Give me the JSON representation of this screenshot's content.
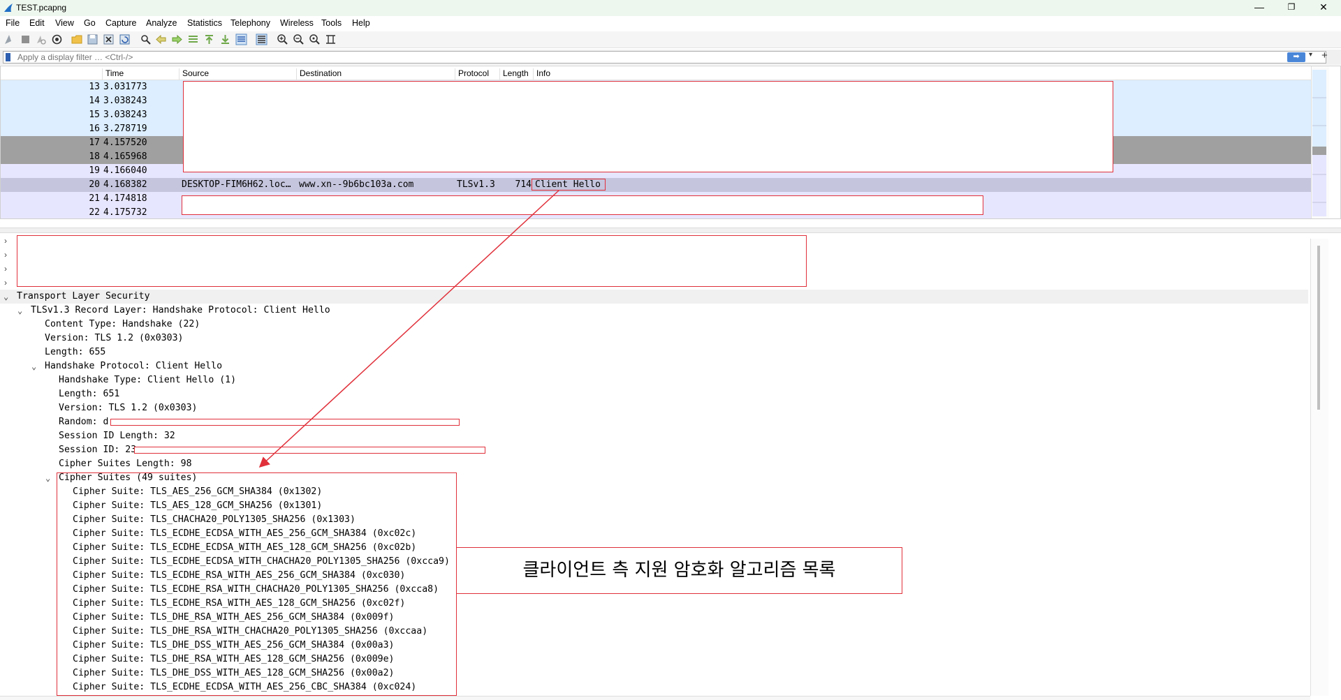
{
  "window": {
    "title": "TEST.pcapng",
    "minimize": "—",
    "restore": "❐",
    "close": "✕"
  },
  "menu": [
    "File",
    "Edit",
    "View",
    "Go",
    "Capture",
    "Analyze",
    "Statistics",
    "Telephony",
    "Wireless",
    "Tools",
    "Help"
  ],
  "filter": {
    "placeholder": "Apply a display filter … <Ctrl-/>",
    "apply_glyph": "➡"
  },
  "packet_list": {
    "columns": [
      "Time",
      "Source",
      "Destination",
      "Protocol",
      "Length",
      "Info"
    ],
    "rows": [
      {
        "no": "13",
        "time": "3.031773",
        "bg": "#dceeff"
      },
      {
        "no": "14",
        "time": "3.038243",
        "bg": "#dceeff"
      },
      {
        "no": "15",
        "time": "3.038243",
        "bg": "#dceeff"
      },
      {
        "no": "16",
        "time": "3.278719",
        "bg": "#dceeff"
      },
      {
        "no": "17",
        "time": "4.157520",
        "bg": "#a0a0a0"
      },
      {
        "no": "18",
        "time": "4.165968",
        "bg": "#a0a0a0"
      },
      {
        "no": "19",
        "time": "4.166040",
        "bg": "#e7e6ff"
      },
      {
        "no": "20",
        "time": "4.168382",
        "source": "DESKTOP-FIM6H62.loc…",
        "destination": "www.xn--9b6bc103a.com",
        "protocol": "TLSv1.3",
        "length": "714",
        "info": "Client Hello",
        "bg": "#c5c5de"
      },
      {
        "no": "21",
        "time": "4.174818",
        "bg": "#e7e6ff"
      },
      {
        "no": "22",
        "time": "4.175732",
        "bg": "#e7e6ff"
      }
    ]
  },
  "detail": {
    "tls": "Transport Layer Security",
    "record": "TLSv1.3 Record Layer: Handshake Protocol: Client Hello",
    "content_type": "Content Type: Handshake (22)",
    "version": "Version: TLS 1.2 (0x0303)",
    "length": "Length: 655",
    "handshake": "Handshake Protocol: Client Hello",
    "hs_type": "Handshake Type: Client Hello (1)",
    "hs_length": "Length: 651",
    "hs_version": "Version: TLS 1.2 (0x0303)",
    "random": "Random: d",
    "session_id_length": "Session ID Length: 32",
    "session_id": "Session ID: 23",
    "cipher_suites_length": "Cipher Suites Length: 98",
    "cipher_suites": "Cipher Suites (49 suites)",
    "suites": [
      "Cipher Suite: TLS_AES_256_GCM_SHA384 (0x1302)",
      "Cipher Suite: TLS_AES_128_GCM_SHA256 (0x1301)",
      "Cipher Suite: TLS_CHACHA20_POLY1305_SHA256 (0x1303)",
      "Cipher Suite: TLS_ECDHE_ECDSA_WITH_AES_256_GCM_SHA384 (0xc02c)",
      "Cipher Suite: TLS_ECDHE_ECDSA_WITH_AES_128_GCM_SHA256 (0xc02b)",
      "Cipher Suite: TLS_ECDHE_ECDSA_WITH_CHACHA20_POLY1305_SHA256 (0xcca9)",
      "Cipher Suite: TLS_ECDHE_RSA_WITH_AES_256_GCM_SHA384 (0xc030)",
      "Cipher Suite: TLS_ECDHE_RSA_WITH_CHACHA20_POLY1305_SHA256 (0xcca8)",
      "Cipher Suite: TLS_ECDHE_RSA_WITH_AES_128_GCM_SHA256 (0xc02f)",
      "Cipher Suite: TLS_DHE_RSA_WITH_AES_256_GCM_SHA384 (0x009f)",
      "Cipher Suite: TLS_DHE_RSA_WITH_CHACHA20_POLY1305_SHA256 (0xccaa)",
      "Cipher Suite: TLS_DHE_DSS_WITH_AES_256_GCM_SHA384 (0x00a3)",
      "Cipher Suite: TLS_DHE_RSA_WITH_AES_128_GCM_SHA256 (0x009e)",
      "Cipher Suite: TLS_DHE_DSS_WITH_AES_128_GCM_SHA256 (0x00a2)",
      "Cipher Suite: TLS_ECDHE_ECDSA_WITH_AES_256_CBC_SHA384 (0xc024)"
    ]
  },
  "annotation": {
    "callout": "클라이언트 측 지원 암호화 알고리즘 목록",
    "color": "#e0303a"
  }
}
